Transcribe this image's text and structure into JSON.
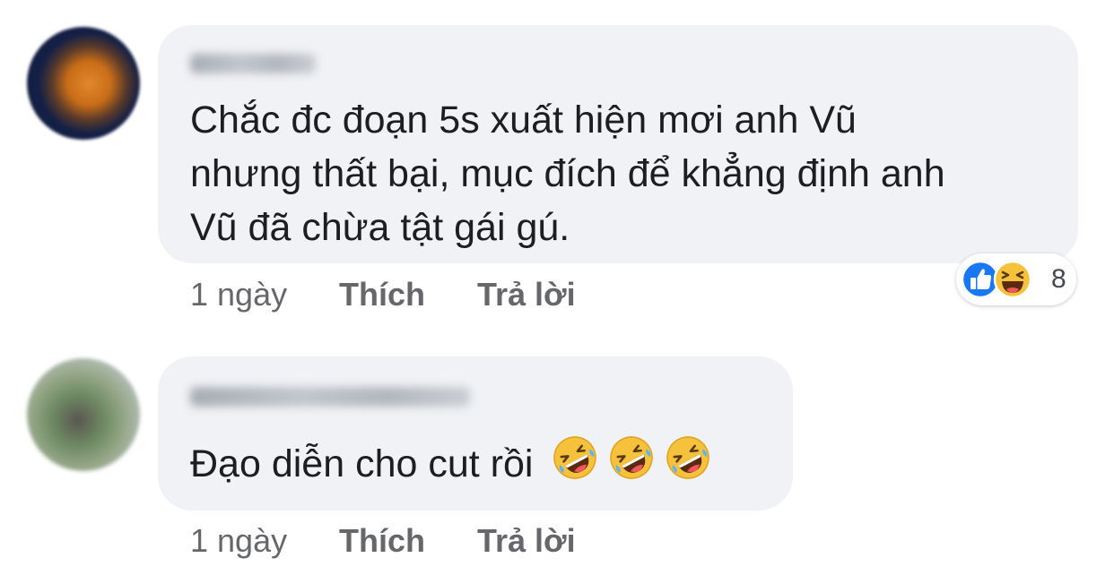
{
  "comments": [
    {
      "text_lines": [
        "Chắc đc đoạn 5s xuất hiện mơi anh Vũ",
        "nhưng thất bại, mục đích để khẳng định anh",
        "Vũ đã chừa tật gái gú."
      ],
      "time": "1 ngày",
      "like_label": "Thích",
      "reply_label": "Trả lời",
      "reactions": {
        "icons": [
          "like-icon",
          "haha-icon"
        ],
        "count": "8"
      }
    },
    {
      "text": "Đạo diễn cho cut rồi",
      "emojis": [
        "rofl-icon",
        "rofl-icon",
        "rofl-icon"
      ],
      "time": "1 ngày",
      "like_label": "Thích",
      "reply_label": "Trả lời"
    }
  ],
  "colors": {
    "bubble": "#f1f2f5",
    "meta_text": "#65676b",
    "like_blue": "#1877f2",
    "emoji_yellow": "#f7c23b"
  }
}
